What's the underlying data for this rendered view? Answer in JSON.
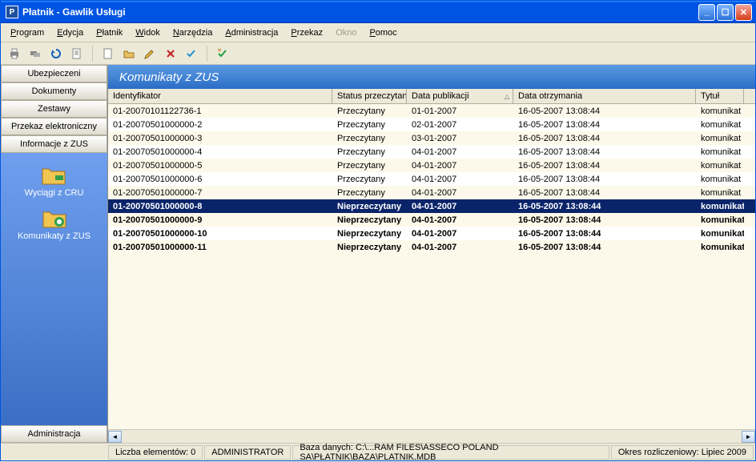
{
  "window": {
    "title": "Płatnik - Gawlik Usługi",
    "icon_letter": "P"
  },
  "menu": {
    "program": "Program",
    "edycja": "Edycja",
    "platnik": "Płatnik",
    "widok": "Widok",
    "narzedzia": "Narzędzia",
    "administracja": "Administracja",
    "przekaz": "Przekaz",
    "okno": "Okno",
    "pomoc": "Pomoc"
  },
  "sidebar": {
    "buttons": {
      "ubezpieczeni": "Ubezpieczeni",
      "dokumenty": "Dokumenty",
      "zestawy": "Zestawy",
      "przekaz": "Przekaz elektroniczny",
      "informacje": "Informacje z ZUS"
    },
    "items": {
      "wyciagi": "Wyciągi z CRU",
      "komunikaty": "Komunikaty z ZUS"
    },
    "admin": "Administracja"
  },
  "panel": {
    "title": "Komunikaty z ZUS"
  },
  "columns": {
    "id": "Identyfikator",
    "status": "Status przeczytania",
    "pub": "Data publikacji",
    "recv": "Data otrzymania",
    "title": "Tytuł"
  },
  "rows": [
    {
      "id": "01-20070101122736-1",
      "status": "Przeczytany",
      "pub": "01-01-2007",
      "recv": "16-05-2007 13:08:44",
      "title": "komunikat nr",
      "unread": false,
      "selected": false
    },
    {
      "id": "01-20070501000000-2",
      "status": "Przeczytany",
      "pub": "02-01-2007",
      "recv": "16-05-2007 13:08:44",
      "title": "komunikat nr",
      "unread": false,
      "selected": false
    },
    {
      "id": "01-20070501000000-3",
      "status": "Przeczytany",
      "pub": "03-01-2007",
      "recv": "16-05-2007 13:08:44",
      "title": "komunikat nr",
      "unread": false,
      "selected": false
    },
    {
      "id": "01-20070501000000-4",
      "status": "Przeczytany",
      "pub": "04-01-2007",
      "recv": "16-05-2007 13:08:44",
      "title": "komunikat nr",
      "unread": false,
      "selected": false
    },
    {
      "id": "01-20070501000000-5",
      "status": "Przeczytany",
      "pub": "04-01-2007",
      "recv": "16-05-2007 13:08:44",
      "title": "komunikat nr",
      "unread": false,
      "selected": false
    },
    {
      "id": "01-20070501000000-6",
      "status": "Przeczytany",
      "pub": "04-01-2007",
      "recv": "16-05-2007 13:08:44",
      "title": "komunikat nr",
      "unread": false,
      "selected": false
    },
    {
      "id": "01-20070501000000-7",
      "status": "Przeczytany",
      "pub": "04-01-2007",
      "recv": "16-05-2007 13:08:44",
      "title": "komunikat nr",
      "unread": false,
      "selected": false
    },
    {
      "id": "01-20070501000000-8",
      "status": "Nieprzeczytany",
      "pub": "04-01-2007",
      "recv": "16-05-2007 13:08:44",
      "title": "komunikat",
      "unread": true,
      "selected": true
    },
    {
      "id": "01-20070501000000-9",
      "status": "Nieprzeczytany",
      "pub": "04-01-2007",
      "recv": "16-05-2007 13:08:44",
      "title": "komunikat",
      "unread": true,
      "selected": false
    },
    {
      "id": "01-20070501000000-10",
      "status": "Nieprzeczytany",
      "pub": "04-01-2007",
      "recv": "16-05-2007 13:08:44",
      "title": "komunikat",
      "unread": true,
      "selected": false
    },
    {
      "id": "01-20070501000000-11",
      "status": "Nieprzeczytany",
      "pub": "04-01-2007",
      "recv": "16-05-2007 13:08:44",
      "title": "komunikat",
      "unread": true,
      "selected": false
    }
  ],
  "statusbar": {
    "count": "Liczba elementów: 0",
    "user": "ADMINISTRATOR",
    "db": "Baza danych: C:\\...RAM FILES\\ASSECO POLAND SA\\PŁATNIK\\BAZA\\PLATNIK.MDB",
    "period": "Okres rozliczeniowy: Lipiec 2009"
  }
}
